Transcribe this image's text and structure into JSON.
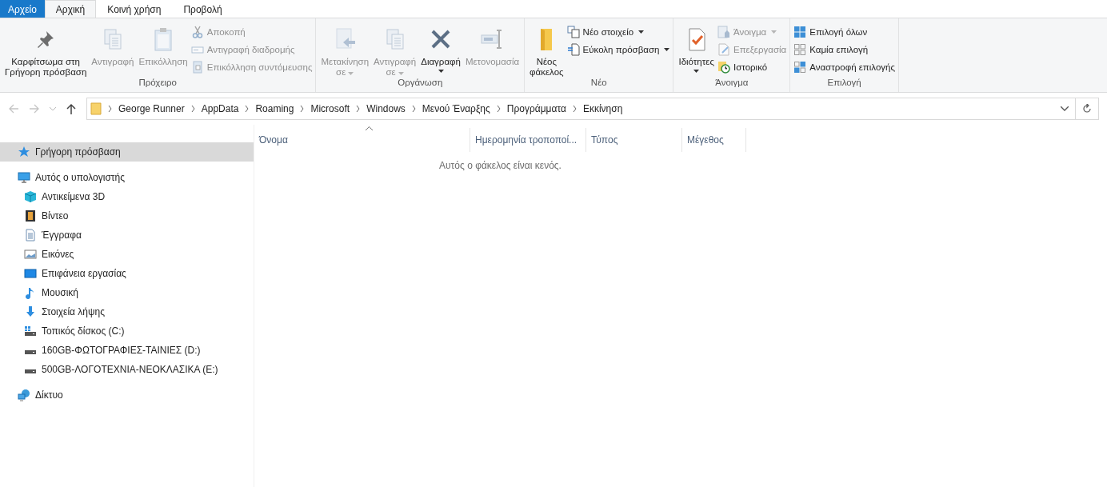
{
  "tabs": [
    {
      "label": "Αρχείο",
      "kind": "file",
      "selected": false
    },
    {
      "label": "Αρχική",
      "kind": "tab",
      "selected": true
    },
    {
      "label": "Κοινή χρήση",
      "kind": "tab",
      "selected": false
    },
    {
      "label": "Προβολή",
      "kind": "tab",
      "selected": false
    }
  ],
  "ribbon": {
    "groups": [
      {
        "label": "Πρόχειρο",
        "columns": [
          {
            "kind": "large",
            "lines": [
              "Καρφίτσωμα στη",
              "Γρήγορη πρόσβαση"
            ],
            "disabled": false,
            "dropdown": false
          },
          {
            "kind": "large",
            "lines": [
              "Αντιγραφή"
            ],
            "disabled": true,
            "dropdown": false
          },
          {
            "kind": "large",
            "lines": [
              "Επικόλληση"
            ],
            "disabled": true,
            "dropdown": false
          },
          {
            "kind": "stack",
            "items": [
              {
                "label": "Αποκοπή",
                "disabled": true,
                "dropdown": false
              },
              {
                "label": "Αντιγραφή διαδρομής",
                "disabled": true,
                "dropdown": false
              },
              {
                "label": "Επικόλληση συντόμευσης",
                "disabled": true,
                "dropdown": false
              }
            ]
          }
        ]
      },
      {
        "label": "Οργάνωση",
        "columns": [
          {
            "kind": "large",
            "lines": [
              "Μετακίνηση",
              "σε"
            ],
            "disabled": true,
            "dropdown": true
          },
          {
            "kind": "large",
            "lines": [
              "Αντιγραφή",
              "σε"
            ],
            "disabled": true,
            "dropdown": true
          },
          {
            "kind": "large",
            "lines": [
              "Διαγραφή"
            ],
            "disabled": false,
            "dropdown": true
          },
          {
            "kind": "large",
            "lines": [
              "Μετονομασία"
            ],
            "disabled": true,
            "dropdown": false
          }
        ]
      },
      {
        "label": "Νέο",
        "columns": [
          {
            "kind": "large",
            "lines": [
              "Νέος",
              "φάκελος"
            ],
            "disabled": false,
            "dropdown": false
          },
          {
            "kind": "stack",
            "items": [
              {
                "label": "Νέο στοιχείο",
                "disabled": false,
                "dropdown": true
              },
              {
                "label": "Εύκολη πρόσβαση",
                "disabled": false,
                "dropdown": true
              }
            ]
          }
        ]
      },
      {
        "label": "Άνοιγμα",
        "columns": [
          {
            "kind": "large",
            "lines": [
              "Ιδιότητες"
            ],
            "disabled": false,
            "dropdown": true
          },
          {
            "kind": "stack",
            "items": [
              {
                "label": "Άνοιγμα",
                "disabled": true,
                "dropdown": true
              },
              {
                "label": "Επεξεργασία",
                "disabled": true,
                "dropdown": false
              },
              {
                "label": "Ιστορικό",
                "disabled": false,
                "dropdown": false
              }
            ]
          }
        ]
      },
      {
        "label": "Επιλογή",
        "columns": [
          {
            "kind": "stack",
            "items": [
              {
                "label": "Επιλογή όλων",
                "disabled": false,
                "dropdown": false
              },
              {
                "label": "Καμία επιλογή",
                "disabled": false,
                "dropdown": false
              },
              {
                "label": "Αναστροφή επιλογής",
                "disabled": false,
                "dropdown": false
              }
            ]
          }
        ]
      }
    ]
  },
  "navigation": {
    "back_disabled": true,
    "forward_disabled": true
  },
  "address_bar": {
    "segments": [
      "George Runner",
      "AppData",
      "Roaming",
      "Microsoft",
      "Windows",
      "Μενού Έναρξης",
      "Προγράμματα",
      "Εκκίνηση"
    ]
  },
  "sidebar": {
    "items": [
      {
        "label": "Γρήγορη πρόσβαση",
        "selected": true
      },
      {
        "label": "Αυτός ο υπολογιστής",
        "selected": false,
        "children": [
          {
            "label": "Αντικείμενα 3D",
            "selected": false
          },
          {
            "label": "Βίντεο",
            "selected": false
          },
          {
            "label": "Έγγραφα",
            "selected": false
          },
          {
            "label": "Εικόνες",
            "selected": false
          },
          {
            "label": "Επιφάνεια εργασίας",
            "selected": false
          },
          {
            "label": "Μουσική",
            "selected": false
          },
          {
            "label": "Στοιχεία λήψης",
            "selected": false
          },
          {
            "label": "Τοπικός δίσκος (C:)",
            "selected": false
          },
          {
            "label": "160GB-ΦΩΤΟΓΡΑΦΙΕΣ-ΤΑΙΝΙΕΣ  (D:)",
            "selected": false
          },
          {
            "label": "500GB-ΛΟΓΟΤΕΧΝΙΑ-ΝΕΟΚΛΑΣΙΚΑ (E:)",
            "selected": false
          }
        ]
      },
      {
        "label": "Δίκτυο",
        "selected": false
      }
    ]
  },
  "file_list": {
    "columns": [
      {
        "label": "Όνομα",
        "sorted": true
      },
      {
        "label": "Ημερομηνία τροποποί...",
        "sorted": false
      },
      {
        "label": "Τύπος",
        "sorted": false
      },
      {
        "label": "Μέγεθος",
        "sorted": false
      }
    ],
    "empty_message": "Αυτός ο φάκελος είναι κενός."
  }
}
